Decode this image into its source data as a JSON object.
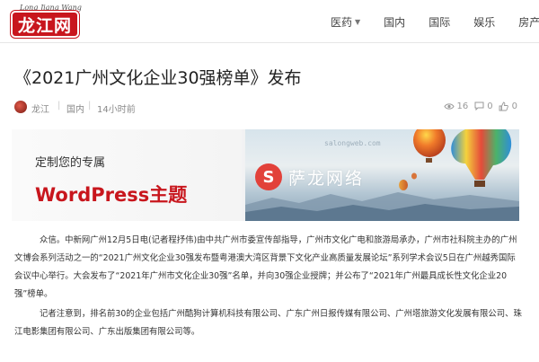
{
  "header": {
    "logo_script": "Long Jiang Wang",
    "logo_text": "龙江网",
    "nav": [
      {
        "label": "医药",
        "has_dropdown": true
      },
      {
        "label": "国内",
        "has_dropdown": false
      },
      {
        "label": "国际",
        "has_dropdown": false
      },
      {
        "label": "娱乐",
        "has_dropdown": false
      },
      {
        "label": "房产",
        "has_dropdown": false
      }
    ]
  },
  "article": {
    "title": "《2021广州文化企业30强榜单》发布",
    "author": "龙江",
    "category": "国内",
    "time": "14小时前",
    "views": "16",
    "comments": "0",
    "likes": "0",
    "paragraphs": [
      "众信。中新网广州12月5日电(记者程抒伟)由中共广州市委宣传部指导，广州市文化广电和旅游局承办，广州市社科院主办的广州文博会系列活动之一的“2021广州文化企业30强发布暨粤港澳大湾区背景下文化产业高质量发展论坛”系列学术会议5日在广州越秀国际会议中心举行。大会发布了“2021年广州市文化企业30强”名单，并向30强企业授牌；并公布了“2021年广州最具成长性文化企业20强”榜单。",
      "记者注意到，排名前30的企业包括广州酷狗计算机科技有限公司、广东广州日报传媒有限公司、广州塔旅游文化发展有限公司、珠江电影集团有限公司、广东出版集团有限公司等。"
    ]
  },
  "banner": {
    "line1": "定制您的专属",
    "line2": "WordPress主题",
    "url": "salongweb.com",
    "badge": "S",
    "brand": "萨龙网络"
  },
  "colors": {
    "brand_red": "#c8161d",
    "badge_red": "#e2413a"
  }
}
